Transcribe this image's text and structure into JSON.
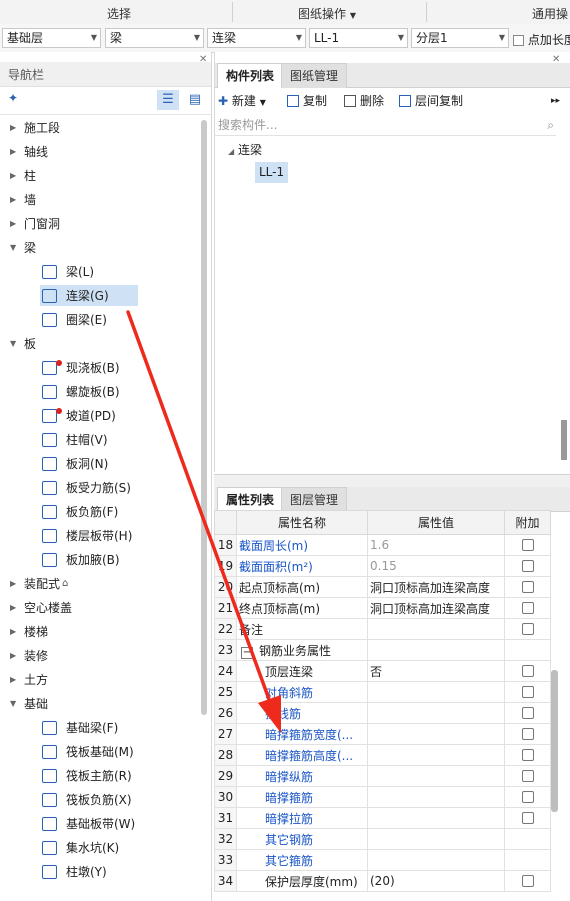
{
  "ribbon": {
    "tabs": [
      "选择",
      "图纸操作",
      "通用操"
    ],
    "dropdown_tab": "图纸操作"
  },
  "filters": {
    "floor": "基础层",
    "category": "梁",
    "type": "连梁",
    "component": "LL-1",
    "layer": "分层1",
    "checkbox_label": "点加长度"
  },
  "nav": {
    "title": "导航栏",
    "items": [
      {
        "label": "施工段",
        "expanded": false
      },
      {
        "label": "轴线",
        "expanded": false
      },
      {
        "label": "柱",
        "expanded": false
      },
      {
        "label": "墙",
        "expanded": false
      },
      {
        "label": "门窗洞",
        "expanded": false
      },
      {
        "label": "梁",
        "expanded": true
      },
      {
        "label": "梁(L)",
        "sub": true,
        "icon": "beam-icon"
      },
      {
        "label": "连梁(G)",
        "sub": true,
        "icon": "coupling-beam-icon",
        "selected": true
      },
      {
        "label": "圈梁(E)",
        "sub": true,
        "icon": "ring-beam-icon"
      },
      {
        "label": "板",
        "expanded": true
      },
      {
        "label": "现浇板(B)",
        "sub": true,
        "icon": "cast-slab-icon",
        "dot": true
      },
      {
        "label": "螺旋板(B)",
        "sub": true,
        "icon": "spiral-slab-icon"
      },
      {
        "label": "坡道(PD)",
        "sub": true,
        "icon": "ramp-icon",
        "dot": true
      },
      {
        "label": "柱帽(V)",
        "sub": true,
        "icon": "column-cap-icon"
      },
      {
        "label": "板洞(N)",
        "sub": true,
        "icon": "slab-hole-icon"
      },
      {
        "label": "板受力筋(S)",
        "sub": true,
        "icon": "slab-rebar-icon"
      },
      {
        "label": "板负筋(F)",
        "sub": true,
        "icon": "negative-rebar-icon"
      },
      {
        "label": "楼层板带(H)",
        "sub": true,
        "icon": "floor-strip-icon"
      },
      {
        "label": "板加腋(B)",
        "sub": true,
        "icon": "slab-haunch-icon"
      },
      {
        "label": "装配式",
        "expanded": false,
        "lock": true
      },
      {
        "label": "空心楼盖",
        "expanded": false
      },
      {
        "label": "楼梯",
        "expanded": false
      },
      {
        "label": "装修",
        "expanded": false
      },
      {
        "label": "土方",
        "expanded": false
      },
      {
        "label": "基础",
        "expanded": true
      },
      {
        "label": "基础梁(F)",
        "sub": true,
        "icon": "foundation-beam-icon"
      },
      {
        "label": "筏板基础(M)",
        "sub": true,
        "icon": "raft-foundation-icon"
      },
      {
        "label": "筏板主筋(R)",
        "sub": true,
        "icon": "raft-main-rebar-icon"
      },
      {
        "label": "筏板负筋(X)",
        "sub": true,
        "icon": "raft-negative-rebar-icon"
      },
      {
        "label": "基础板带(W)",
        "sub": true,
        "icon": "foundation-strip-icon"
      },
      {
        "label": "集水坑(K)",
        "sub": true,
        "icon": "sump-pit-icon"
      },
      {
        "label": "柱墩(Y)",
        "sub": true,
        "icon": "column-pier-icon"
      }
    ]
  },
  "components": {
    "tabs": [
      "构件列表",
      "图纸管理"
    ],
    "toolbar": {
      "new": "新建",
      "copy": "复制",
      "delete": "删除",
      "floor_copy": "层间复制"
    },
    "search_placeholder": "搜索构件...",
    "tree_root": "连梁",
    "tree_item": "LL-1"
  },
  "properties": {
    "tabs": [
      "属性列表",
      "图层管理"
    ],
    "headers": [
      "属性名称",
      "属性值",
      "附加"
    ],
    "rows": [
      {
        "num": "18",
        "name": "截面周长(m)",
        "value": "1.6",
        "blue": true,
        "gray": true,
        "check": true
      },
      {
        "num": "19",
        "name": "截面面积(m²)",
        "value": "0.15",
        "blue": true,
        "gray": true,
        "check": true
      },
      {
        "num": "20",
        "name": "起点顶标高(m)",
        "value": "洞口顶标高加连梁高度",
        "check": true
      },
      {
        "num": "21",
        "name": "终点顶标高(m)",
        "value": "洞口顶标高加连梁高度",
        "check": true
      },
      {
        "num": "22",
        "name": "备注",
        "value": "",
        "check": true
      },
      {
        "num": "23",
        "name": "钢筋业务属性",
        "value": "",
        "group": true
      },
      {
        "num": "24",
        "name": "顶层连梁",
        "value": "否",
        "indent": true,
        "check": true
      },
      {
        "num": "25",
        "name": "对角斜筋",
        "value": "",
        "indent": true,
        "blue": true,
        "check": true
      },
      {
        "num": "26",
        "name": "折线筋",
        "value": "",
        "indent": true,
        "blue": true,
        "check": true
      },
      {
        "num": "27",
        "name": "暗撑箍筋宽度(...",
        "value": "",
        "indent": true,
        "blue": true,
        "check": true
      },
      {
        "num": "28",
        "name": "暗撑箍筋高度(...",
        "value": "",
        "indent": true,
        "blue": true,
        "check": true
      },
      {
        "num": "29",
        "name": "暗撑纵筋",
        "value": "",
        "indent": true,
        "blue": true,
        "check": true
      },
      {
        "num": "30",
        "name": "暗撑箍筋",
        "value": "",
        "indent": true,
        "blue": true,
        "check": true
      },
      {
        "num": "31",
        "name": "暗撑拉筋",
        "value": "",
        "indent": true,
        "blue": true,
        "check": true
      },
      {
        "num": "32",
        "name": "其它钢筋",
        "value": "",
        "indent": true,
        "blue": true,
        "check": false
      },
      {
        "num": "33",
        "name": "其它箍筋",
        "value": "",
        "indent": true,
        "blue": true,
        "check": false
      },
      {
        "num": "34",
        "name": "保护层厚度(mm)",
        "value": "(20)",
        "indent": true,
        "check": true
      }
    ]
  }
}
